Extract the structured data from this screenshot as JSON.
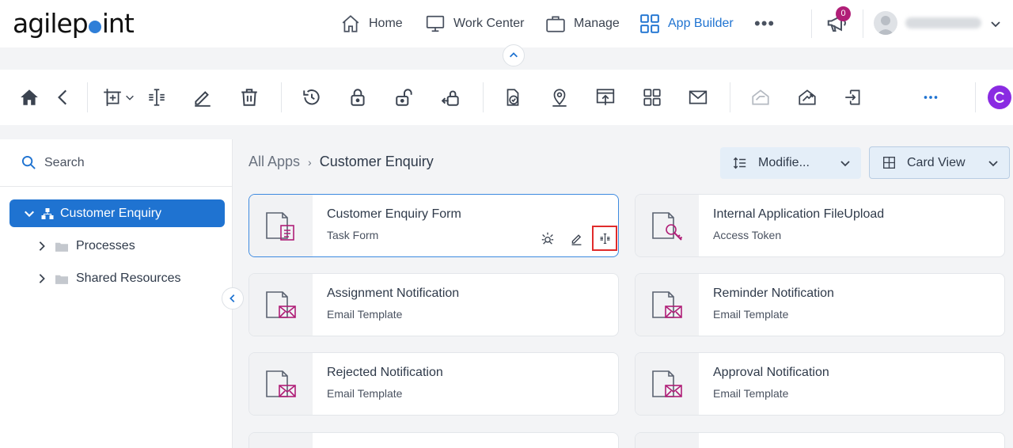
{
  "brand": {
    "logo_text_pre": "agilep",
    "logo_text_post": "int"
  },
  "nav": {
    "items": [
      {
        "label": "Home",
        "icon": "home-icon"
      },
      {
        "label": "Work Center",
        "icon": "monitor-icon"
      },
      {
        "label": "Manage",
        "icon": "briefcase-icon"
      },
      {
        "label": "App Builder",
        "icon": "grid-icon",
        "active": true
      }
    ],
    "more": "•••",
    "notifications": {
      "count": "0"
    },
    "user": {
      "name": ""
    }
  },
  "sidebar": {
    "search_label": "Search",
    "root": "Customer Enquiry",
    "children": [
      "Processes",
      "Shared Resources"
    ]
  },
  "breadcrumb": {
    "root": "All Apps",
    "separator": "›",
    "current": "Customer Enquiry"
  },
  "sort": {
    "label": "Modifie..."
  },
  "view": {
    "label": "Card View"
  },
  "cards": [
    {
      "title": "Customer Enquiry Form",
      "subtitle": "Task Form",
      "icon": "task-form-icon"
    },
    {
      "title": "Internal Application FileUpload",
      "subtitle": "Access Token",
      "icon": "access-token-icon"
    },
    {
      "title": "Assignment Notification",
      "subtitle": "Email Template",
      "icon": "email-template-icon"
    },
    {
      "title": "Reminder Notification",
      "subtitle": "Email Template",
      "icon": "email-template-icon"
    },
    {
      "title": "Rejected Notification",
      "subtitle": "Email Template",
      "icon": "email-template-icon"
    },
    {
      "title": "Approval Notification",
      "subtitle": "Email Template",
      "icon": "email-template-icon"
    }
  ],
  "colors": {
    "accent": "#1f73d1",
    "magenta": "#b01e77",
    "selection": "#e02b2b"
  }
}
